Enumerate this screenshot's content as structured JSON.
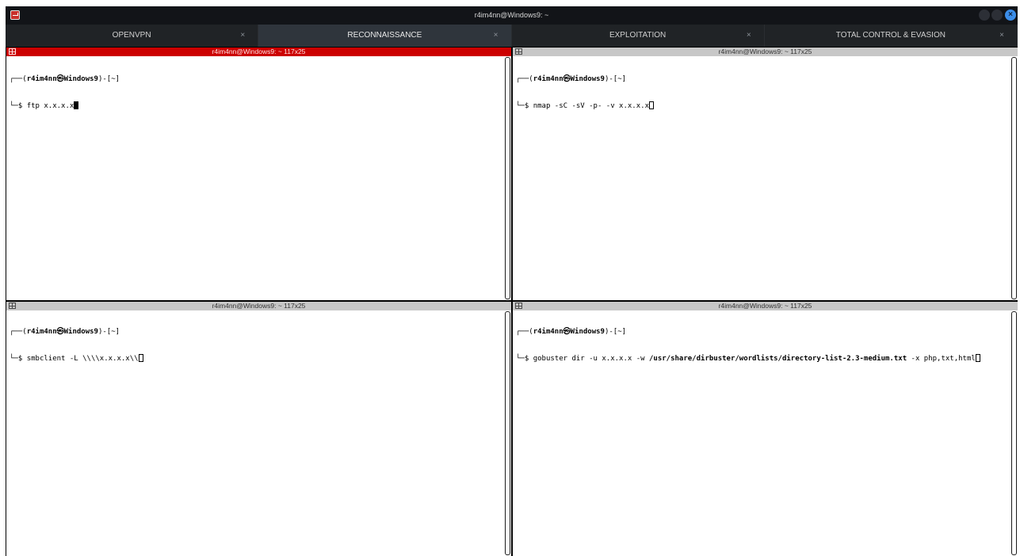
{
  "window": {
    "title": "r4im4nn@Windows9: ~"
  },
  "tabs": [
    {
      "label": "OPENVPN",
      "close": "×",
      "active": false
    },
    {
      "label": "RECONNAISSANCE",
      "close": "×",
      "active": true
    },
    {
      "label": "EXPLOITATION",
      "close": "×",
      "active": false
    },
    {
      "label": "TOTAL CONTROL & EVASION",
      "close": "×",
      "active": false
    }
  ],
  "panes": [
    {
      "header": "r4im4nn@Windows9: ~ 117x25",
      "active": true,
      "prompt_prefix": "┌──(",
      "user_host": "r4im4nn㉿Windows9",
      "prompt_dir": ")-[~]",
      "cmd_prefix": "└─$ ",
      "command": "ftp x.x.x.x",
      "command_bold": "",
      "command_suffix": ""
    },
    {
      "header": "r4im4nn@Windows9: ~ 117x25",
      "active": false,
      "prompt_prefix": "┌──(",
      "user_host": "r4im4nn㉿Windows9",
      "prompt_dir": ")-[~]",
      "cmd_prefix": "└─$ ",
      "command": "nmap -sC -sV -p- -v x.x.x.x",
      "command_bold": "",
      "command_suffix": ""
    },
    {
      "header": "r4im4nn@Windows9: ~ 117x25",
      "active": false,
      "prompt_prefix": "┌──(",
      "user_host": "r4im4nn㉿Windows9",
      "prompt_dir": ")-[~]",
      "cmd_prefix": "└─$ ",
      "command": "smbclient -L \\\\\\\\x.x.x.x\\\\",
      "command_bold": "",
      "command_suffix": ""
    },
    {
      "header": "r4im4nn@Windows9: ~ 117x25",
      "active": false,
      "prompt_prefix": "┌──(",
      "user_host": "r4im4nn㉿Windows9",
      "prompt_dir": ")-[~]",
      "cmd_prefix": "└─$ ",
      "command": "gobuster dir -u x.x.x.x -w ",
      "command_bold": "/usr/share/dirbuster/wordlists/directory-list-2.3-medium.txt",
      "command_suffix": " -x php,txt,html"
    }
  ],
  "colors": {
    "active_header": "#cc0000",
    "inactive_header": "#c7c7c7",
    "tabbar": "#202326",
    "titlebar": "#121418",
    "close_button": "#3b8de8"
  }
}
